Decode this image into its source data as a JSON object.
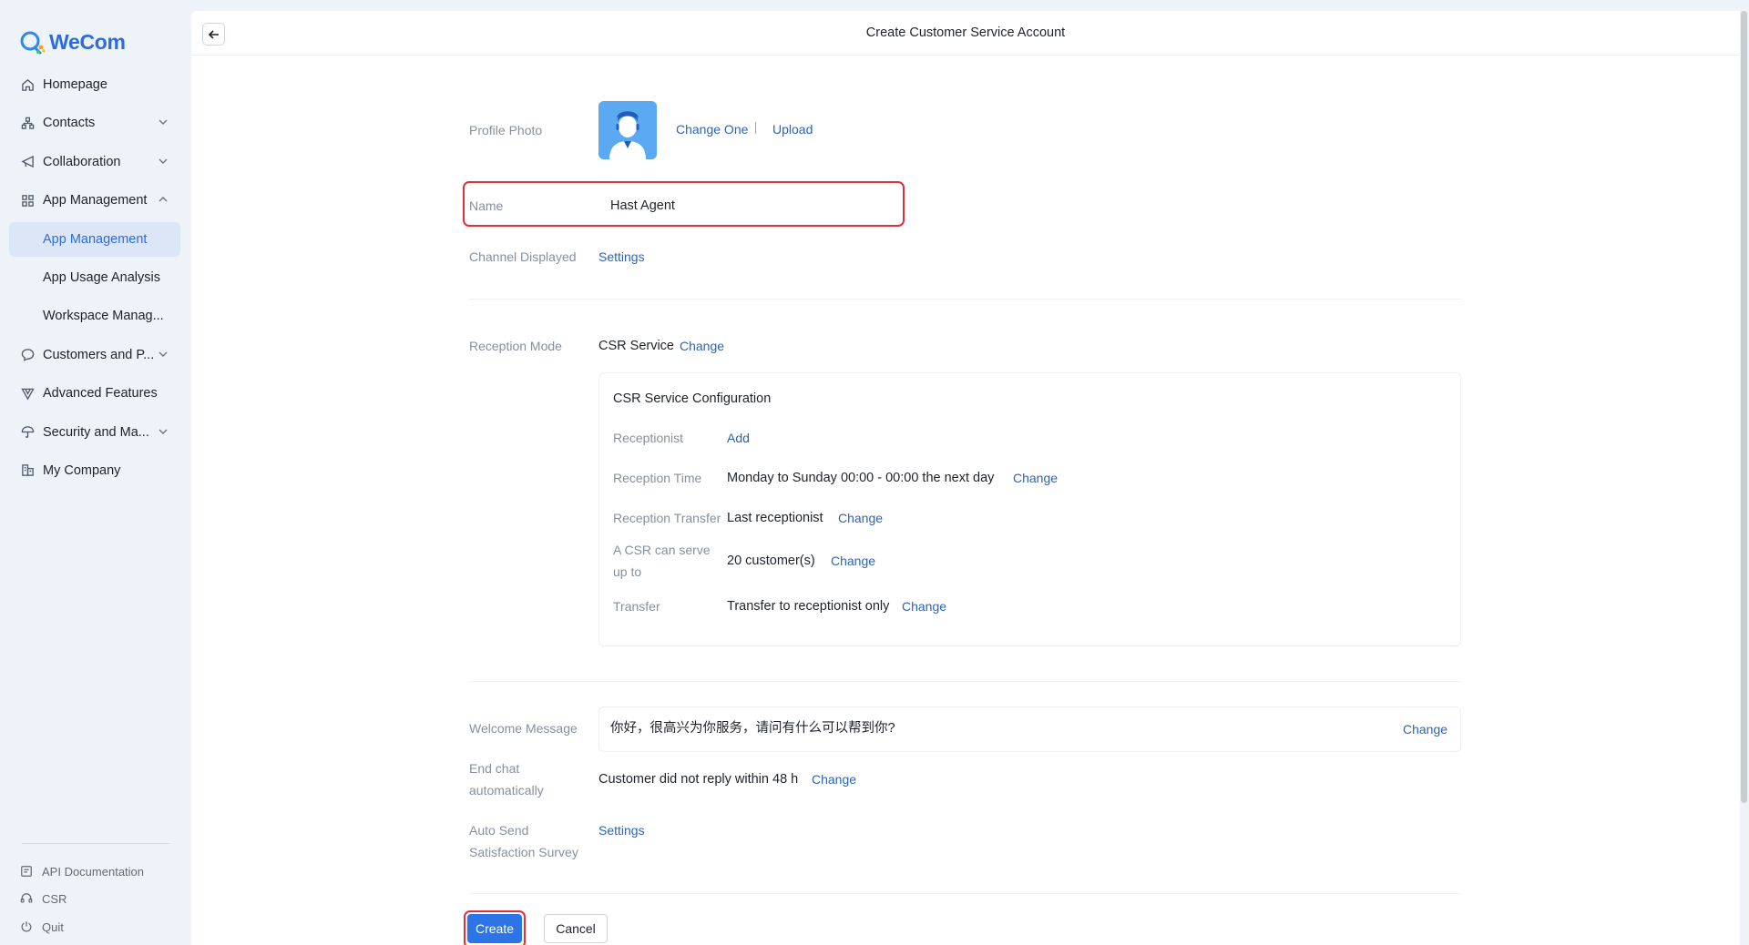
{
  "app": {
    "logo_text": "WeCom"
  },
  "sidebar": {
    "items": [
      {
        "label": "Homepage",
        "icon": "home-icon",
        "expandable": false
      },
      {
        "label": "Contacts",
        "icon": "contacts-icon",
        "expandable": true,
        "expanded": false
      },
      {
        "label": "Collaboration",
        "icon": "collaboration-icon",
        "expandable": true,
        "expanded": false
      },
      {
        "label": "App Management",
        "icon": "apps-grid-icon",
        "expandable": true,
        "expanded": true
      },
      {
        "label": "App Management",
        "sub": true,
        "active": true
      },
      {
        "label": "App Usage Analysis",
        "sub": true
      },
      {
        "label": "Workspace Manag...",
        "sub": true
      },
      {
        "label": "Customers and P...",
        "icon": "chat-bubble-icon",
        "expandable": true,
        "expanded": false
      },
      {
        "label": "Advanced Features",
        "icon": "advanced-icon",
        "expandable": false
      },
      {
        "label": "Security and Ma...",
        "icon": "umbrella-icon",
        "expandable": true,
        "expanded": false
      },
      {
        "label": "My Company",
        "icon": "company-icon",
        "expandable": false
      }
    ],
    "bottom": [
      {
        "label": "API Documentation",
        "icon": "document-icon"
      },
      {
        "label": "CSR",
        "icon": "headset-icon"
      },
      {
        "label": "Quit",
        "icon": "power-icon"
      }
    ]
  },
  "header": {
    "title": "Create Customer Service Account"
  },
  "form": {
    "profile_photo": {
      "label": "Profile Photo",
      "change_link": "Change One",
      "separator": "|",
      "upload_link": "Upload"
    },
    "name": {
      "label": "Name",
      "value": "Hast Agent"
    },
    "channel": {
      "label": "Channel Displayed",
      "link": "Settings"
    },
    "reception_mode": {
      "label": "Reception Mode",
      "value": "CSR Service",
      "link": "Change"
    },
    "csr_config": {
      "title": "CSR Service Configuration",
      "receptionist": {
        "label": "Receptionist",
        "link": "Add"
      },
      "reception_time": {
        "label": "Reception Time",
        "value": "Monday to Sunday 00:00 - 00:00 the next day",
        "link": "Change"
      },
      "reception_transfer": {
        "label": "Reception Transfer",
        "value": "Last receptionist",
        "link": "Change"
      },
      "serve_up_to": {
        "label_line1": "A CSR can serve",
        "label_line2": "up to",
        "value": "20 customer(s)",
        "link": "Change"
      },
      "transfer": {
        "label": "Transfer",
        "value": "Transfer to receptionist only",
        "link": "Change"
      }
    },
    "welcome": {
      "label": "Welcome Message",
      "value": "你好，很高兴为你服务，请问有什么可以帮到你?",
      "link": "Change"
    },
    "end_chat": {
      "label_line1": "End chat",
      "label_line2": "automatically",
      "value": "Customer did not reply within 48 h",
      "link": "Change"
    },
    "survey": {
      "label_line1": "Auto Send",
      "label_line2": "Satisfaction Survey",
      "link": "Settings"
    }
  },
  "actions": {
    "create": "Create",
    "cancel": "Cancel"
  },
  "colors": {
    "accent": "#2b6cde",
    "link": "#2d64b4",
    "primary_button": "#2d74e6",
    "highlight": "#e0303e"
  }
}
